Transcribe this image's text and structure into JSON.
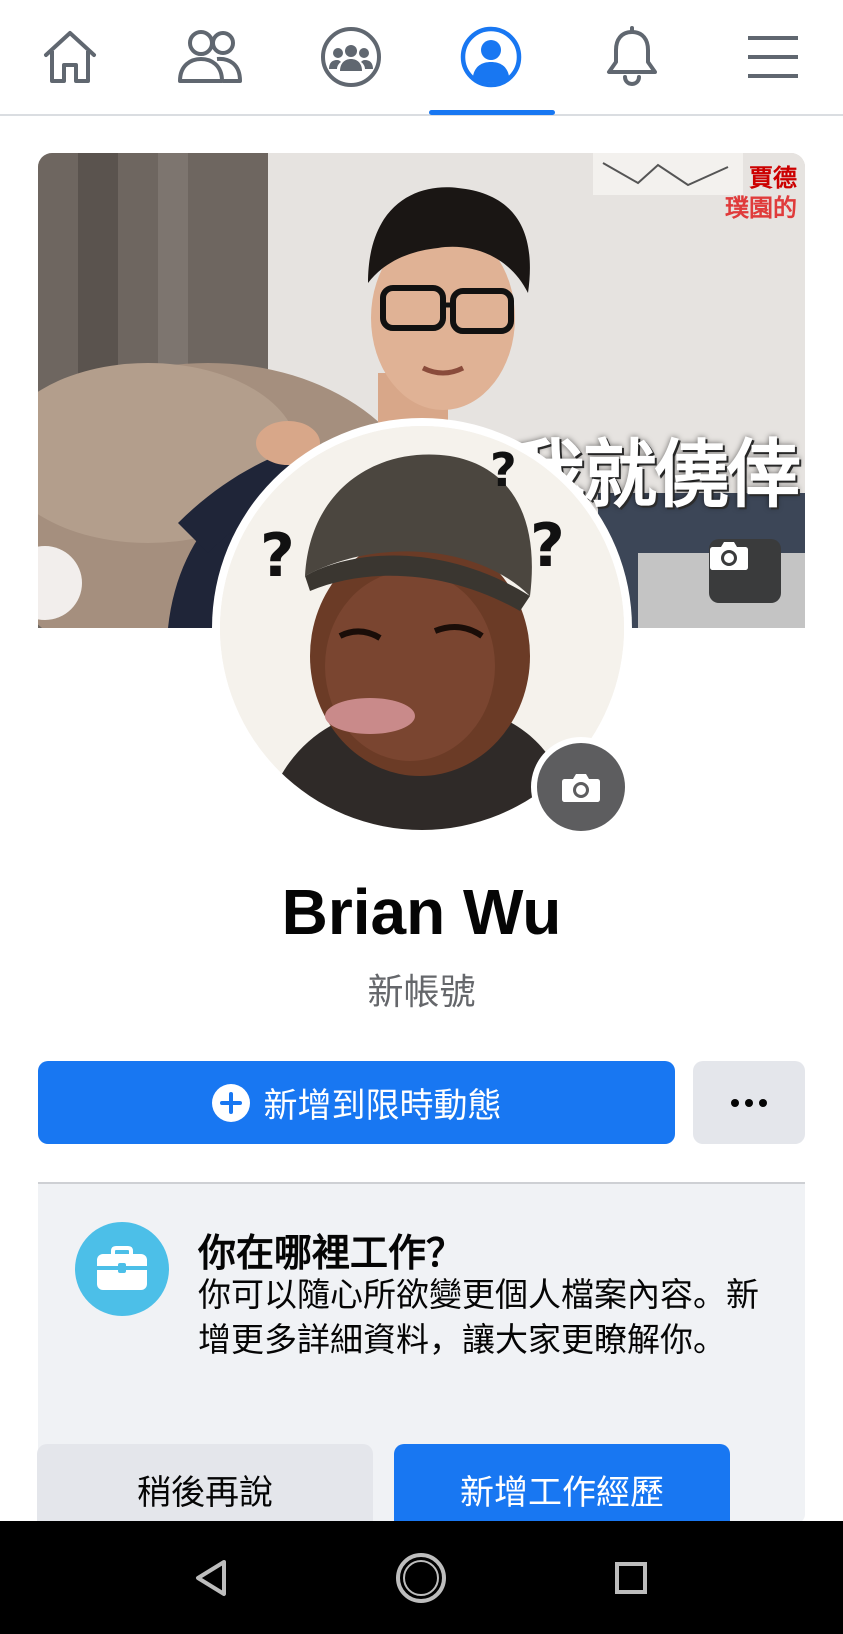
{
  "nav": {
    "tabs": [
      {
        "id": "home",
        "icon": "home-icon",
        "active": false
      },
      {
        "id": "friends",
        "icon": "friends-icon",
        "active": false
      },
      {
        "id": "groups",
        "icon": "groups-icon",
        "active": false
      },
      {
        "id": "profile",
        "icon": "profile-icon",
        "active": true
      },
      {
        "id": "notifications",
        "icon": "bell-icon",
        "active": false
      },
      {
        "id": "menu",
        "icon": "hamburger-menu-icon",
        "active": false
      }
    ],
    "accent_color": "#1877f2"
  },
  "cover": {
    "caption": "我就僥倖",
    "note_line1": "賈德",
    "note_line2": "璞園的",
    "camera_icon": "camera-icon"
  },
  "profile": {
    "name": "Brian Wu",
    "subtitle": "新帳號",
    "avatar_camera_icon": "camera-icon"
  },
  "actions": {
    "add_story_label": "新增到限時動態",
    "more_icon": "more-dots-icon"
  },
  "work_card": {
    "icon": "briefcase-icon",
    "title": "你在哪裡工作？",
    "body": "你可以隨心所欲變更個人檔案內容。新增更多詳細資料，讓大家更瞭解你。",
    "later_label": "稍後再說",
    "add_label": "新增工作經歷"
  },
  "system_nav": {
    "back_icon": "back-triangle-icon",
    "home_icon": "home-circle-icon",
    "recents_icon": "recents-square-icon"
  },
  "colors": {
    "primary": "#1877f2",
    "secondary_button": "#e4e6eb",
    "card_bg": "#f0f2f5",
    "muted_text": "#65676b",
    "briefcase_bg": "#4cbfe8"
  }
}
